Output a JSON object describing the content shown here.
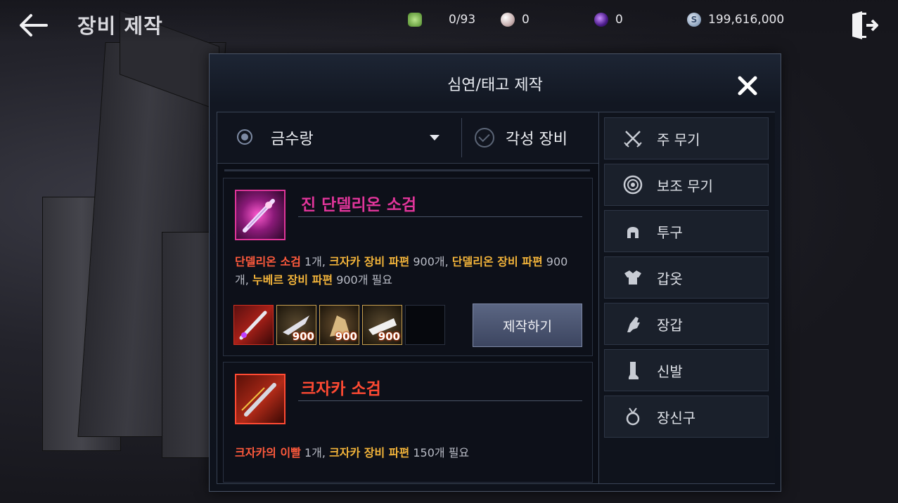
{
  "header": {
    "title": "장비 제작",
    "resources": [
      {
        "icon": "green-gem-icon",
        "value": "0/93"
      },
      {
        "icon": "pearl-icon",
        "value": "0"
      },
      {
        "icon": "purple-orb-icon",
        "value": "0"
      },
      {
        "icon": "silver-coin-icon",
        "value": "199,616,000"
      }
    ]
  },
  "modal": {
    "title": "심연/태고 제작",
    "filter": {
      "selected_class": "금수랑",
      "awakening_label": "각성 장비"
    },
    "recipes": [
      {
        "name": "진 단델리온 소검",
        "name_color": "#e0359a",
        "requirements": [
          {
            "item": "단델리온 소검",
            "count": "1개",
            "color": "#ff5a3c",
            "sep": ", "
          },
          {
            "item": "크자카 장비 파편",
            "count": "900개",
            "color": "#f3b43a",
            "sep": ", "
          },
          {
            "item": "단델리온 장비 파편",
            "count": "900개",
            "color": "#f3b43a",
            "sep": ", "
          },
          {
            "item": "누베르 장비 파편",
            "count": "900개 필요",
            "color": "#f3b43a",
            "sep": ""
          }
        ],
        "materials": [
          {
            "icon": "red-dagger-icon",
            "qty": ""
          },
          {
            "icon": "kzarka-fragment-icon",
            "qty": "900"
          },
          {
            "icon": "dandelion-fragment-icon",
            "qty": "900"
          },
          {
            "icon": "nouver-fragment-icon",
            "qty": "900"
          },
          {
            "icon": "empty-slot",
            "qty": ""
          }
        ],
        "craft_label": "제작하기"
      },
      {
        "name": "크자카 소검",
        "name_color": "#ff4a33",
        "requirements": [
          {
            "item": "크자카의 이빨",
            "count": "1개",
            "color": "#ff5a3c",
            "sep": ", "
          },
          {
            "item": "크자카 장비 파편",
            "count": "150개 필요",
            "color": "#f3b43a",
            "sep": ""
          }
        ]
      }
    ],
    "categories": [
      {
        "label": "주 무기",
        "icon": "crossed-swords-icon"
      },
      {
        "label": "보조 무기",
        "icon": "round-shield-icon"
      },
      {
        "label": "투구",
        "icon": "helmet-icon"
      },
      {
        "label": "갑옷",
        "icon": "armor-icon"
      },
      {
        "label": "장갑",
        "icon": "gloves-icon"
      },
      {
        "label": "신발",
        "icon": "boots-icon"
      },
      {
        "label": "장신구",
        "icon": "accessory-icon"
      }
    ]
  }
}
